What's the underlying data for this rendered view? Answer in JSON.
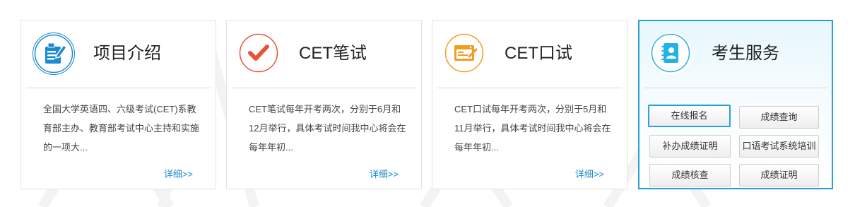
{
  "cards": [
    {
      "title": "项目介绍",
      "icon": "document-edit-icon",
      "desc": "全国大学英语四、六级考试(CET)系教育部主办、教育部考试中心主持和实施的一项大...",
      "more": "详细>>"
    },
    {
      "title": "CET笔试",
      "icon": "checkmark-icon",
      "desc": "CET笔试每年开考两次，分别于6月和12月举行，具体考试时间我中心将会在每年年初...",
      "more": "详细>>"
    },
    {
      "title": "CET口试",
      "icon": "browser-window-icon",
      "desc": "CET口试每年开考两次，分别于5月和11月举行，具体考试时间我中心将会在每年年初...",
      "more": "详细>>"
    }
  ],
  "services": {
    "title": "考生服务",
    "icon": "contact-book-icon",
    "buttons": [
      "在线报名",
      "成绩查询",
      "补办成绩证明",
      "口语考试系统培训",
      "成绩核查",
      "成绩证明"
    ],
    "active_button": "在线报名"
  },
  "colors": {
    "blue": "#1a8ad1",
    "orange_red": "#e8543a",
    "orange": "#f39c1f",
    "cyan": "#22b3e6",
    "active_border": "#2a9fe0"
  }
}
